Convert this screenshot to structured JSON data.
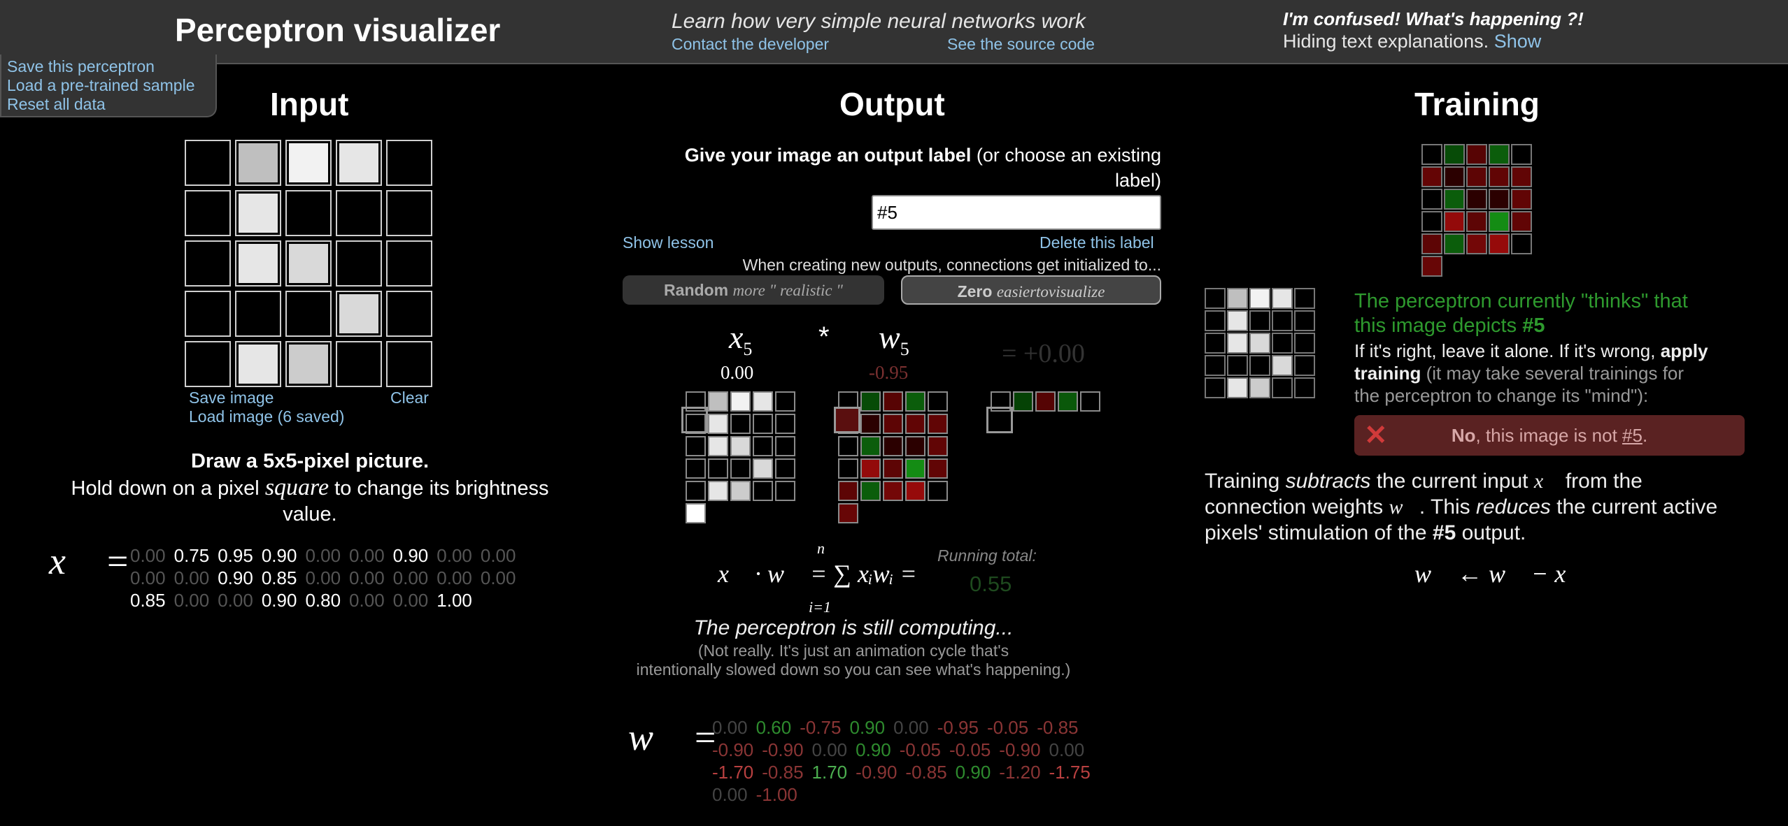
{
  "header": {
    "title": "Perceptron visualizer",
    "tagline": "Learn how very simple neural networks work",
    "contact_link": "Contact the developer",
    "source_link": "See the source code",
    "confused": "I'm confused! What's happening ?!",
    "hiding_text": "Hiding text explanations.",
    "show_link": "Show"
  },
  "menu": {
    "save": "Save this perceptron",
    "load": "Load a pre-trained sample",
    "reset": "Reset all data"
  },
  "input": {
    "heading": "Input",
    "save_image": "Save image",
    "clear": "Clear",
    "load_image": "Load image (6 saved)",
    "instr_bold": "Draw a 5x5-pixel picture.",
    "instr_1": "Hold down on a pixel",
    "instr_square": "square",
    "instr_2": "to change its brightness",
    "instr_3": "value.",
    "vector_symbol": "x⃗ =",
    "pixels": [
      0.0,
      0.75,
      0.95,
      0.9,
      0.0,
      0.0,
      0.9,
      0.0,
      0.0,
      0.0,
      0.0,
      0.9,
      0.85,
      0.0,
      0.0,
      0.0,
      0.0,
      0.0,
      0.85,
      0.0,
      0.0,
      0.9,
      0.8,
      0.0,
      0.0,
      1.0
    ],
    "rows": [
      [
        "0.00",
        "0.75",
        "0.95",
        "0.90",
        "0.00",
        "0.00",
        "0.90",
        "0.00",
        "0.00"
      ],
      [
        "0.00",
        "0.00",
        "0.90",
        "0.85",
        "0.00",
        "0.00",
        "0.00",
        "0.00",
        "0.00"
      ],
      [
        "0.85",
        "0.00",
        "0.00",
        "0.90",
        "0.80",
        "0.00",
        "0.00",
        "1.00"
      ]
    ]
  },
  "output": {
    "heading": "Output",
    "label_prompt_bold": "Give your image an output label",
    "label_prompt_rest": "(or choose an existing",
    "label_prompt_rest2": "label)",
    "label_value": "#5",
    "show_lesson": "Show lesson",
    "delete_label": "Delete this label",
    "init_text": "When creating new outputs, connections get initialized to...",
    "random_bold": "Random",
    "random_italic": "more \" realistic \"",
    "zero_bold": "Zero",
    "zero_italic": "easiertovisualize",
    "x_sym": "x",
    "x_sub": "5",
    "times": "*",
    "w_sym": "w",
    "w_sub": "5",
    "x5_value": "0.00",
    "w5_value": "-0.95",
    "product": "= +0.00",
    "formula": "x⃗ · w⃗ = ∑ xᵢwᵢ =",
    "sum_top": "n",
    "sum_bottom": "i=1",
    "running_label": "Running total:",
    "running_value": "0.55",
    "computing": "The perceptron is still computing...",
    "computing_note_1": "(Not really. It's just an animation cycle that's",
    "computing_note_2": "intentionally slowed down so you can see what's happening.)",
    "w_vector_symbol": "w⃗ =",
    "weights": [
      0.0,
      0.6,
      -0.75,
      0.9,
      0.0,
      -0.95,
      -0.05,
      -0.85,
      -0.9,
      -0.9,
      0.0,
      0.9,
      -0.05,
      -0.05,
      -0.9,
      0.0,
      -1.7,
      -0.85,
      1.7,
      -0.9,
      -0.85,
      0.9,
      -1.2,
      -1.75,
      0.0,
      -1.0
    ],
    "w_rows": [
      [
        "0.00",
        "0.60",
        "-0.75",
        "0.90",
        "0.00",
        "-0.95",
        "-0.05",
        "-0.85"
      ],
      [
        "-0.90",
        "-0.90",
        "0.00",
        "0.90",
        "-0.05",
        "-0.05",
        "-0.90",
        "0.00"
      ],
      [
        "-1.70",
        "-0.85",
        "1.70",
        "-0.90",
        "-0.85",
        "0.90",
        "-1.20",
        "-1.75"
      ],
      [
        "0.00",
        "-1.00"
      ]
    ]
  },
  "training": {
    "heading": "Training",
    "thinks_1": "The perceptron currently \"thinks\" that",
    "thinks_2": "this image depicts",
    "thinks_label": "#5",
    "right_1": "If it's right, leave it alone. If it's wrong,",
    "right_bold": "apply",
    "right_bold2": "training",
    "right_2": "(it may take several trainings for",
    "right_3": "the perceptron to change its \"mind\"):",
    "no_bold": "No",
    "no_rest": ", this image is not",
    "no_label": "#5",
    "expl_1a": "Training",
    "expl_1b": "subtracts",
    "expl_1c": "the current input",
    "expl_1d": "from the",
    "expl_2a": "connection weights",
    "expl_2b": ". This",
    "expl_2c": "reduces",
    "expl_2d": "the current active",
    "expl_3a": "pixels' stimulation of the",
    "expl_3b": "#5",
    "expl_3c": "output.",
    "update_rule": "w⃗ ← w⃗ − x⃗"
  },
  "colors": {
    "accent": "#8fc3e8",
    "green": "#2e9a2e",
    "red": "#d9534f",
    "header_bg": "#333333"
  }
}
